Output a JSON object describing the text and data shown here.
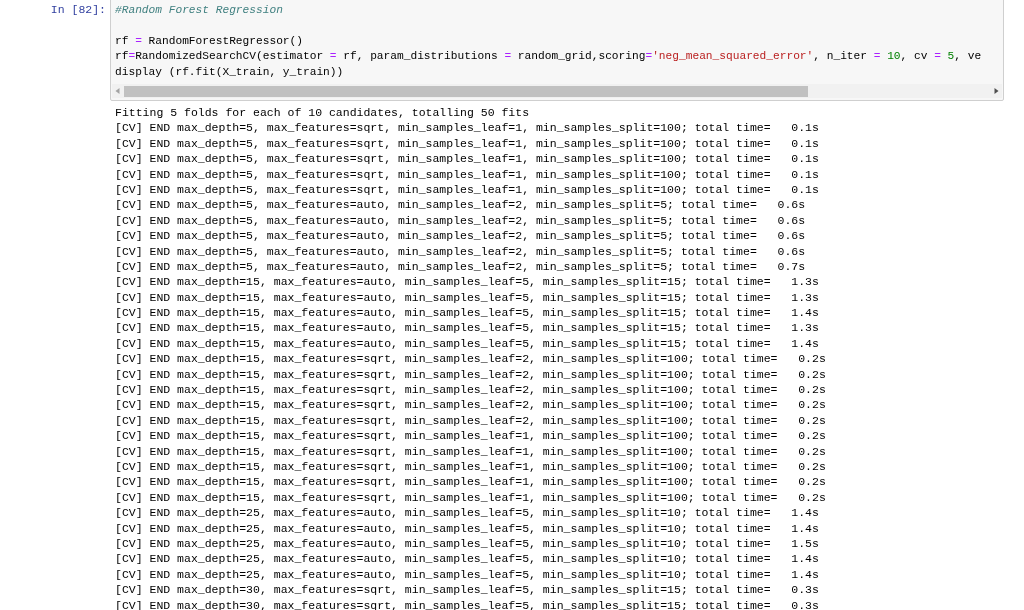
{
  "cell": {
    "prompt": "In [82]:",
    "code_lines": [
      [
        {
          "kind": "comment",
          "text": "#Random Forest Regression"
        }
      ],
      [
        {
          "kind": "blank_before"
        },
        {
          "kind": "plain",
          "text": "rf "
        },
        {
          "kind": "operator",
          "text": "="
        },
        {
          "kind": "plain",
          "text": " RandomForestRegressor()"
        }
      ],
      [
        {
          "kind": "plain",
          "text": "rf"
        },
        {
          "kind": "operator",
          "text": "="
        },
        {
          "kind": "plain",
          "text": "RandomizedSearchCV(estimator "
        },
        {
          "kind": "operator",
          "text": "="
        },
        {
          "kind": "plain",
          "text": " rf, param_distributions "
        },
        {
          "kind": "operator",
          "text": "="
        },
        {
          "kind": "plain",
          "text": " random_grid,scoring"
        },
        {
          "kind": "operator",
          "text": "="
        },
        {
          "kind": "string",
          "text": "'neg_mean_squared_error'"
        },
        {
          "kind": "plain",
          "text": ", n_iter "
        },
        {
          "kind": "operator",
          "text": "="
        },
        {
          "kind": "number",
          "text": " 10"
        },
        {
          "kind": "plain",
          "text": ", cv "
        },
        {
          "kind": "operator",
          "text": "="
        },
        {
          "kind": "number",
          "text": " 5"
        },
        {
          "kind": "plain",
          "text": ", ve"
        }
      ],
      [
        {
          "kind": "plain",
          "text": "display (rf.fit(X_train, y_train))"
        }
      ]
    ],
    "output_lines": [
      "Fitting 5 folds for each of 10 candidates, totalling 50 fits",
      "[CV] END max_depth=5, max_features=sqrt, min_samples_leaf=1, min_samples_split=100; total time=   0.1s",
      "[CV] END max_depth=5, max_features=sqrt, min_samples_leaf=1, min_samples_split=100; total time=   0.1s",
      "[CV] END max_depth=5, max_features=sqrt, min_samples_leaf=1, min_samples_split=100; total time=   0.1s",
      "[CV] END max_depth=5, max_features=sqrt, min_samples_leaf=1, min_samples_split=100; total time=   0.1s",
      "[CV] END max_depth=5, max_features=sqrt, min_samples_leaf=1, min_samples_split=100; total time=   0.1s",
      "[CV] END max_depth=5, max_features=auto, min_samples_leaf=2, min_samples_split=5; total time=   0.6s",
      "[CV] END max_depth=5, max_features=auto, min_samples_leaf=2, min_samples_split=5; total time=   0.6s",
      "[CV] END max_depth=5, max_features=auto, min_samples_leaf=2, min_samples_split=5; total time=   0.6s",
      "[CV] END max_depth=5, max_features=auto, min_samples_leaf=2, min_samples_split=5; total time=   0.6s",
      "[CV] END max_depth=5, max_features=auto, min_samples_leaf=2, min_samples_split=5; total time=   0.7s",
      "[CV] END max_depth=15, max_features=auto, min_samples_leaf=5, min_samples_split=15; total time=   1.3s",
      "[CV] END max_depth=15, max_features=auto, min_samples_leaf=5, min_samples_split=15; total time=   1.3s",
      "[CV] END max_depth=15, max_features=auto, min_samples_leaf=5, min_samples_split=15; total time=   1.4s",
      "[CV] END max_depth=15, max_features=auto, min_samples_leaf=5, min_samples_split=15; total time=   1.3s",
      "[CV] END max_depth=15, max_features=auto, min_samples_leaf=5, min_samples_split=15; total time=   1.4s",
      "[CV] END max_depth=15, max_features=sqrt, min_samples_leaf=2, min_samples_split=100; total time=   0.2s",
      "[CV] END max_depth=15, max_features=sqrt, min_samples_leaf=2, min_samples_split=100; total time=   0.2s",
      "[CV] END max_depth=15, max_features=sqrt, min_samples_leaf=2, min_samples_split=100; total time=   0.2s",
      "[CV] END max_depth=15, max_features=sqrt, min_samples_leaf=2, min_samples_split=100; total time=   0.2s",
      "[CV] END max_depth=15, max_features=sqrt, min_samples_leaf=2, min_samples_split=100; total time=   0.2s",
      "[CV] END max_depth=15, max_features=sqrt, min_samples_leaf=1, min_samples_split=100; total time=   0.2s",
      "[CV] END max_depth=15, max_features=sqrt, min_samples_leaf=1, min_samples_split=100; total time=   0.2s",
      "[CV] END max_depth=15, max_features=sqrt, min_samples_leaf=1, min_samples_split=100; total time=   0.2s",
      "[CV] END max_depth=15, max_features=sqrt, min_samples_leaf=1, min_samples_split=100; total time=   0.2s",
      "[CV] END max_depth=15, max_features=sqrt, min_samples_leaf=1, min_samples_split=100; total time=   0.2s",
      "[CV] END max_depth=25, max_features=auto, min_samples_leaf=5, min_samples_split=10; total time=   1.4s",
      "[CV] END max_depth=25, max_features=auto, min_samples_leaf=5, min_samples_split=10; total time=   1.4s",
      "[CV] END max_depth=25, max_features=auto, min_samples_leaf=5, min_samples_split=10; total time=   1.5s",
      "[CV] END max_depth=25, max_features=auto, min_samples_leaf=5, min_samples_split=10; total time=   1.4s",
      "[CV] END max_depth=25, max_features=auto, min_samples_leaf=5, min_samples_split=10; total time=   1.4s",
      "[CV] END max_depth=30, max_features=sqrt, min_samples_leaf=5, min_samples_split=15; total time=   0.3s",
      "[CV] END max_depth=30, max_features=sqrt, min_samples_leaf=5, min_samples_split=15; total time=   0.3s"
    ]
  }
}
